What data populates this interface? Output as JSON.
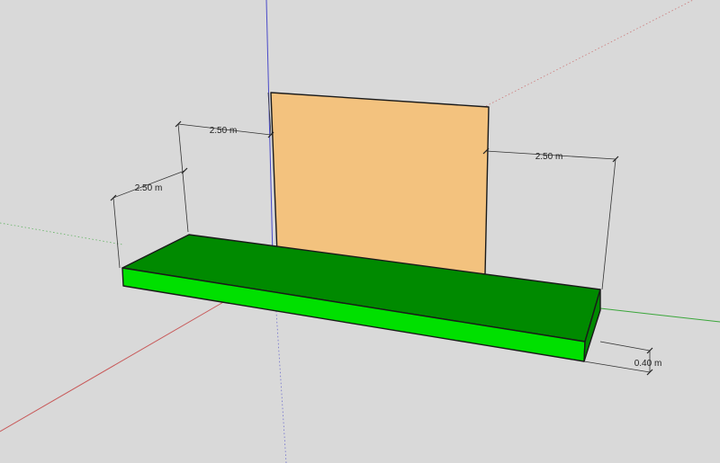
{
  "scene": {
    "background_color": "#d9d9d9",
    "axes": {
      "red_axis_color": "#c85a5a",
      "green_axis_color": "#3aa63a",
      "blue_axis_color": "#4a4ac8"
    },
    "wall": {
      "fill_color": "#f3c27e"
    },
    "footing": {
      "top_color": "#008a00",
      "side_color": "#00e000",
      "edge_color": "#1a1a1a"
    }
  },
  "dimensions": {
    "wall_left_offset": "2.50 m",
    "footing_left_offset": "2.50 m",
    "wall_right_offset": "2.50 m",
    "footing_thickness": "0.40 m"
  }
}
